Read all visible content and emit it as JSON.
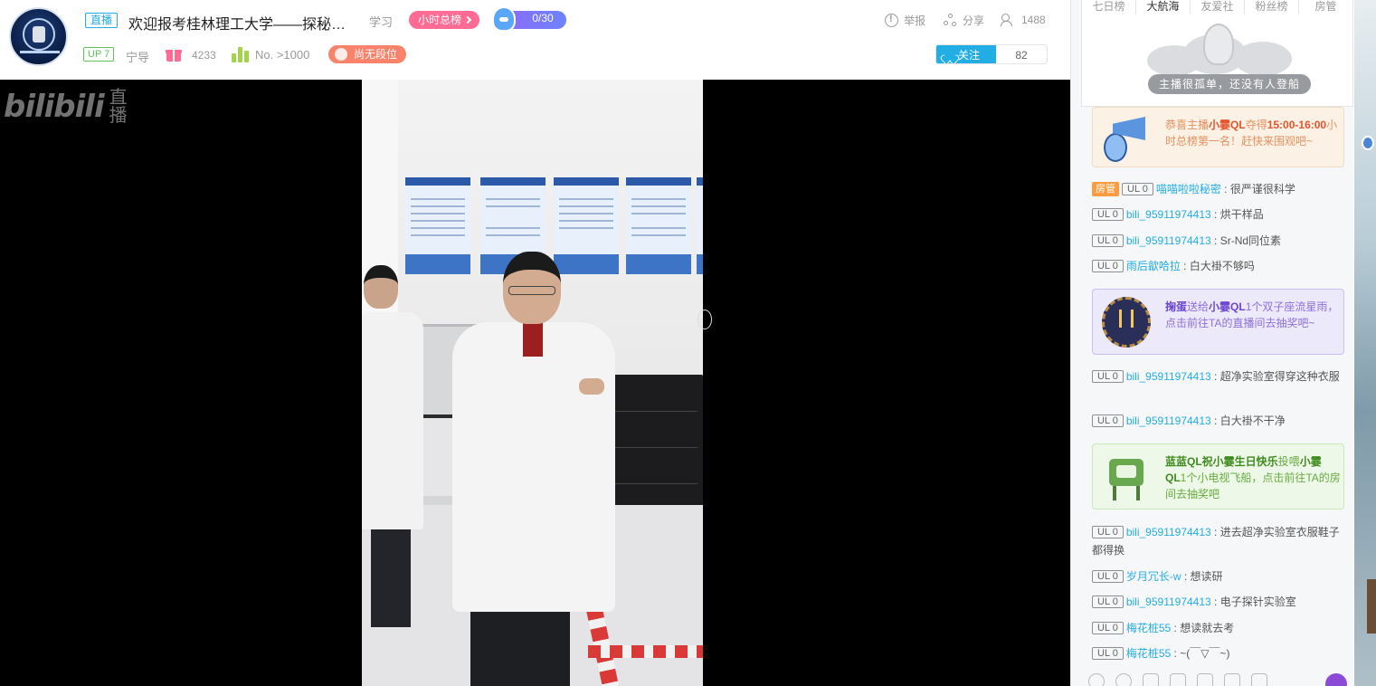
{
  "header": {
    "live_tag": "直播",
    "room_title": "欢迎报考桂林理工大学——探秘…",
    "area": "学习",
    "hourly_rank_button": "小时总榜",
    "task_progress": "0/30",
    "actions": {
      "report": "举报",
      "share": "分享",
      "viewers": "1488"
    },
    "up_level": "UP 7",
    "streamer_name": "宁导",
    "gift_count": "4233",
    "rank_number": "No. >1000",
    "tier_badge": "尚无段位",
    "follow_label": "关注",
    "fans_count": "82"
  },
  "player": {
    "watermark_logo": "bilibili",
    "watermark_text": "直播"
  },
  "rank_panel": {
    "tabs": [
      "七日榜",
      "大航海",
      "友爱社",
      "粉丝榜",
      "房管"
    ],
    "active_tab": "大航海",
    "empty_message": "主播很孤单，还没有人登船"
  },
  "chat": {
    "top_notice": {
      "p1": "恭喜主播",
      "streamer": "小霎QL",
      "p2": "夺得",
      "time": "15:00-16:00",
      "p3": "小时总榜第一名！赶快来围观吧~"
    },
    "messages_a": [
      {
        "admin": "房管",
        "level": "UL 0",
        "user": "喵喵啦啦秘密",
        "text": "很严谨很科学"
      },
      {
        "level": "UL 0",
        "user": "bili_95911974413",
        "text": "烘干样品"
      },
      {
        "level": "UL 0",
        "user": "bili_95911974413",
        "text": "Sr-Nd同位素"
      },
      {
        "level": "UL 0",
        "user": "雨后歙哈拉",
        "text": "白大褂不够吗"
      }
    ],
    "gem_notice": {
      "sender": "掬蛋",
      "p1": "送给",
      "receiver": "小霎QL",
      "p2": "1个双子座流星雨，点击前往TA的直播间去抽奖吧~"
    },
    "messages_b": [
      {
        "level": "UL 0",
        "user": "bili_95911974413",
        "text": "超净实验室得穿这种衣服"
      },
      {
        "level": "UL 0",
        "user": "bili_95911974413",
        "text": "白大褂不干净"
      }
    ],
    "tv_notice": {
      "sender": "蓝蓝QL祝小霎生日快乐",
      "p1": "投喂",
      "receiver": "小霎QL",
      "p2": "1个小电视飞船，点击前往TA的房间去抽奖吧"
    },
    "messages_c": [
      {
        "level": "UL 0",
        "user": "bili_95911974413",
        "text": "进去超净实验室衣服鞋子都得换"
      },
      {
        "level": "UL 0",
        "user": "岁月冗长-w",
        "text": "想读研"
      },
      {
        "level": "UL 0",
        "user": "bili_95911974413",
        "text": "电子探针实验室"
      },
      {
        "level": "UL 0",
        "user": "梅花桩55",
        "text": "想读就去考"
      },
      {
        "level": "UL 0",
        "user": "梅花桩55",
        "text": "~(￣▽￣~)"
      }
    ],
    "toolbar_icons": [
      "emoji-icon",
      "color-icon",
      "gift-icon",
      "danmaku-icon",
      "comment-icon",
      "edit-icon",
      "mark-icon"
    ]
  },
  "colors": {
    "accent_blue": "#23ade5",
    "rank_pink": "#ff6b93",
    "tier_orange": "#f9826a",
    "admin_orange": "#ff9b3f"
  }
}
